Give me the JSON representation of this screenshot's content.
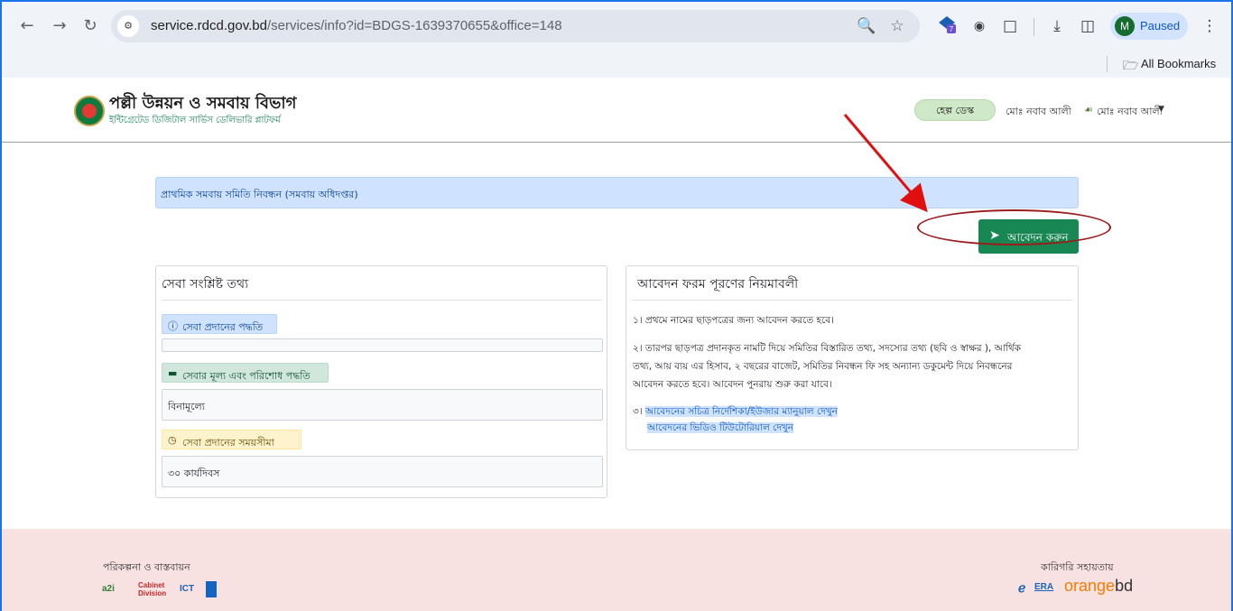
{
  "browser": {
    "url_host": "service.rdcd.gov.bd",
    "url_path": "/services/info?id=BDGS-1639370655&office=148",
    "profile_initial": "M",
    "profile_status": "Paused",
    "extension_badge": "7",
    "bookmarks_label": "All Bookmarks"
  },
  "site": {
    "title": "পল্লী উন্নয়ন ও সমবায় বিভাগ",
    "subtitle": "ইন্টিগ্রেটেড ডিজিটাল সার্ভিস ডেলিভারি প্লাটফর্ম",
    "help_desk": "হেল্প ডেস্ক",
    "user_name": "মোঃ নবাব আলী",
    "user_name_alt": "মোঃ নবাব আলী"
  },
  "service": {
    "name": "প্রাথমিক সমবায় সমিতি নিবন্ধন (সমবায় অধিদপ্তর)",
    "apply_label": "আবেদন করুন"
  },
  "info_card": {
    "title": "সেবা সংশ্লিষ্ট তথ্য",
    "method_label": "সেবা প্রদানের পদ্ধতি",
    "method_value": "",
    "fee_label": "সেবার মূল্য এবং পরিশোধ পদ্ধতি",
    "fee_value": "বিনামূল্যে",
    "time_label": "সেবা প্রদানের সময়সীমা",
    "time_value": "৩০ কার্যদিবস"
  },
  "rules_card": {
    "title": "আবেদন ফরম পূরণের নিয়মাবলী",
    "rule1": "১। প্রথমে নামের ছাড়পত্রের জন্য আবেদন করতে হবে।",
    "rule2_line1": "২। তারপর ছাড়পত্র প্রদানকৃত নামটি দিয়ে সমিতির বিস্তারিত তথ্য, সদস্যের তথ্য (ছবি ও স্বাক্ষর ), আর্থিক",
    "rule2_line2": "তথ্য, আয় ব্যয় এর হিসাব, ২ বছরের বাজেট, সমিতির নিবন্ধন ফি সহ অন্যান্য ডকুমেন্ট দিয়ে নিবন্ধনের",
    "rule2_line3": "আবেদন করতে হবে। আবেদন পুনরায় শুরু করা যাবে।",
    "rule3_prefix": "৩।",
    "rule3_link1": "আবেদনের সচিত্র নির্দেশিকা/ইউজার ম্যানুয়াল দেখুন",
    "rule3_link2": "আবেদনের ভিডিও টিউটোরিয়াল দেখুন"
  },
  "footer": {
    "left_label": "পরিকল্পনা ও বাস্তবায়ন",
    "right_label": "কারিগরি সহায়তায়",
    "logo_a2i": "a2i",
    "logo_cabinet": "Cabinet Division",
    "logo_ict": "ICT",
    "logo_era": "ERA",
    "logo_orange": "orange",
    "logo_bd": "bd"
  },
  "colors": {
    "primary_green": "#198754",
    "info_blue": "#cfe2ff",
    "annotation_red": "#e01010",
    "footer_bg": "#f8e1e1"
  }
}
